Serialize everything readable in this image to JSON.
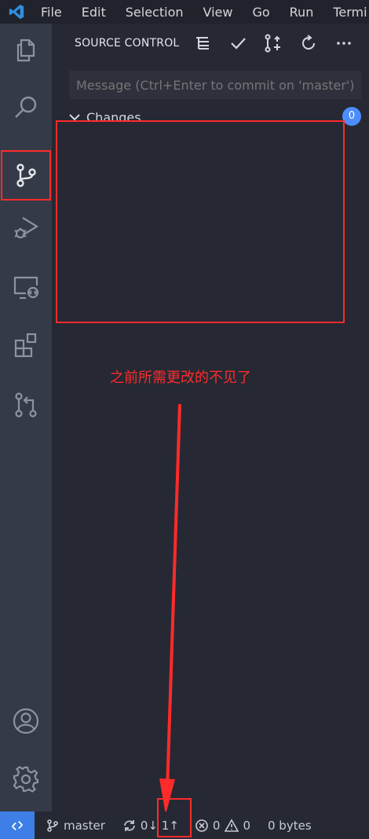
{
  "menubar": {
    "items": [
      "File",
      "Edit",
      "Selection",
      "View",
      "Go",
      "Run",
      "Termi"
    ]
  },
  "activitybar": {
    "items": [
      {
        "icon": "explorer-icon"
      },
      {
        "icon": "search-icon"
      },
      {
        "icon": "source-control-icon",
        "active": true
      },
      {
        "icon": "run-debug-icon"
      },
      {
        "icon": "remote-explorer-icon"
      },
      {
        "icon": "extensions-icon"
      },
      {
        "icon": "pull-requests-icon"
      }
    ],
    "bottom": [
      {
        "icon": "account-icon"
      },
      {
        "icon": "settings-gear-icon"
      }
    ]
  },
  "source_control": {
    "title": "SOURCE CONTROL",
    "message_placeholder": "Message (Ctrl+Enter to commit on 'master')",
    "changes_label": "Changes",
    "changes_count": "0"
  },
  "annotation": {
    "text": "之前所需更改的不见了",
    "color": "#ff2a2a"
  },
  "statusbar": {
    "branch": "master",
    "sync": "0↓ 1↑",
    "errors": "0",
    "warnings": "0",
    "size": "0 bytes"
  },
  "colors": {
    "accent": "#3d7fe6",
    "badge": "#4c8dff",
    "annotation_red": "#ff2a2a",
    "sidebar_bg": "#262934",
    "activitybar_bg": "#353a48"
  }
}
